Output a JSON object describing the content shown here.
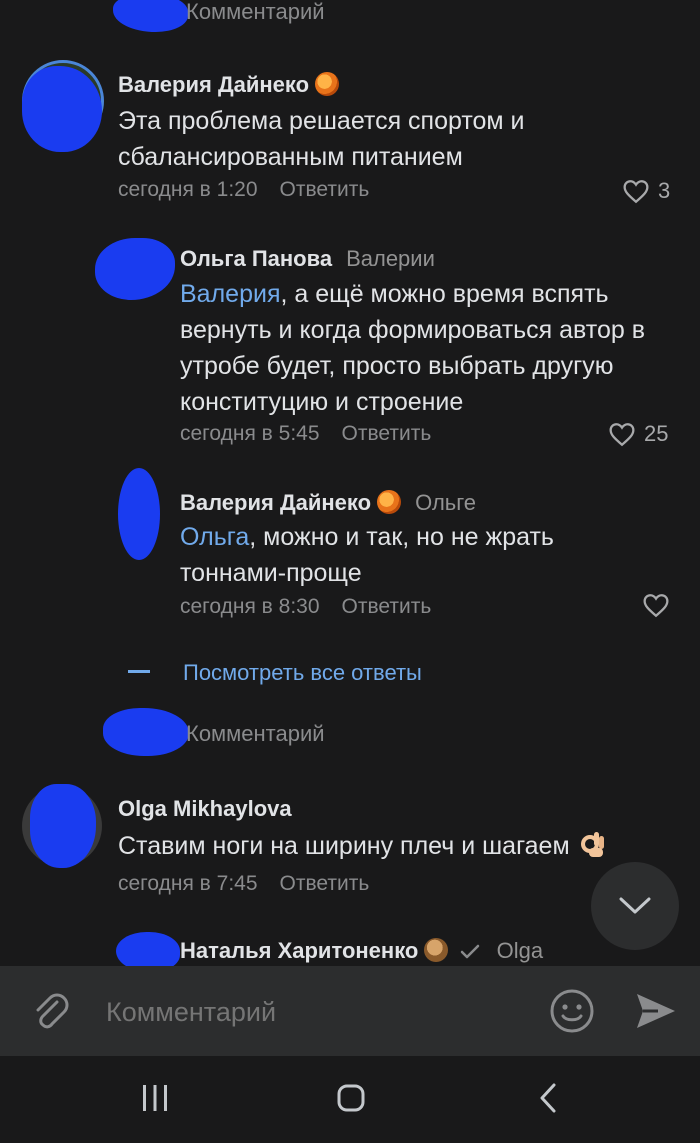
{
  "thread": {
    "top_prompt": "Комментарий",
    "comments": [
      {
        "author": "Валерия Дайнеко",
        "text": "Эта проблема решается спортом и сбалансированным питанием",
        "time": "сегодня в 1:20",
        "reply_label": "Ответить",
        "likes": "3"
      },
      {
        "author": "Ольга Панова",
        "reply_to": "Валерии",
        "mention": "Валерия",
        "text": ", а ещё можно время вспять вернуть и когда формироваться автор в утробе будет, просто выбрать другую конституцию и строение",
        "time": "сегодня в 5:45",
        "reply_label": "Ответить",
        "likes": "25"
      },
      {
        "author": "Валерия Дайнеко",
        "reply_to": "Ольге",
        "mention": "Ольга",
        "text": ", можно и так, но не жрать тоннами-проще",
        "time": "сегодня в 8:30",
        "reply_label": "Ответить"
      },
      {
        "author": "Olga Mikhaylova",
        "text": "Ставим ноги на ширину плеч и шагаем",
        "time": "сегодня в 7:45",
        "reply_label": "Ответить"
      },
      {
        "author": "Наталья Харитоненко",
        "reply_to": "Olga"
      }
    ],
    "show_all_replies": "Посмотреть все ответы",
    "mid_prompt": "Комментарий"
  },
  "composer": {
    "placeholder": "Комментарий"
  },
  "colors": {
    "background": "#19191a",
    "accent": "#71aaeb",
    "panel": "#2c2d2e",
    "redaction": "#1a3cf0"
  },
  "icons": [
    "heart-icon",
    "attach-icon",
    "emoji-icon",
    "send-icon",
    "chevron-down-icon",
    "recent-apps-icon",
    "home-icon",
    "back-icon",
    "verified-check-icon"
  ]
}
